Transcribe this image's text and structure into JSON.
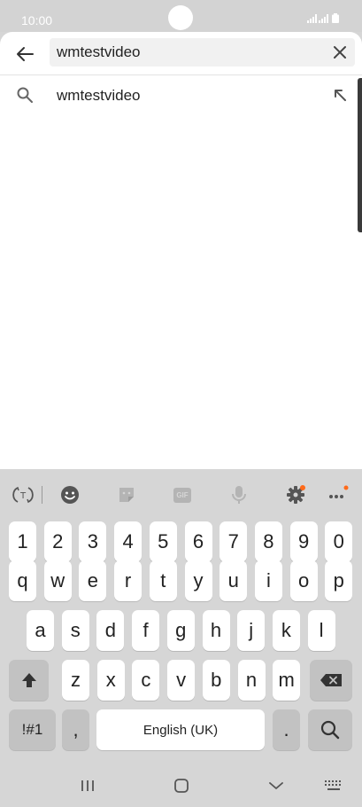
{
  "status_bar": {
    "time": "10:00"
  },
  "search": {
    "value": "wmtestvideo",
    "placeholder": ""
  },
  "suggestions": [
    {
      "text": "wmtestvideo"
    }
  ],
  "keyboard": {
    "number_row": [
      "1",
      "2",
      "3",
      "4",
      "5",
      "6",
      "7",
      "8",
      "9",
      "0"
    ],
    "row1": [
      "q",
      "w",
      "e",
      "r",
      "t",
      "y",
      "u",
      "i",
      "o",
      "p"
    ],
    "row2": [
      "a",
      "s",
      "d",
      "f",
      "g",
      "h",
      "j",
      "k",
      "l"
    ],
    "row3": [
      "z",
      "x",
      "c",
      "v",
      "b",
      "n",
      "m"
    ],
    "symbols_label": "!#1",
    "comma": ",",
    "space_label": "English (UK)",
    "period": ".",
    "gif_label": "GIF"
  },
  "colors": {
    "notification_dot": "#ff6a1a"
  }
}
